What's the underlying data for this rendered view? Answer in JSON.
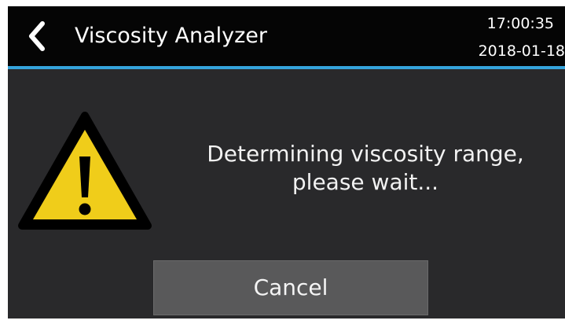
{
  "header": {
    "title": "Viscosity Analyzer",
    "time": "17:00:35",
    "date": "2018-01-18",
    "back_icon": "chevron-left-icon",
    "accent_color": "#35a4dc"
  },
  "dialog": {
    "icon": "warning-icon",
    "message_line1": "Determining viscosity range,",
    "message_line2": "please wait...",
    "cancel_label": "Cancel",
    "warning_fill_color": "#f0cd1a"
  }
}
